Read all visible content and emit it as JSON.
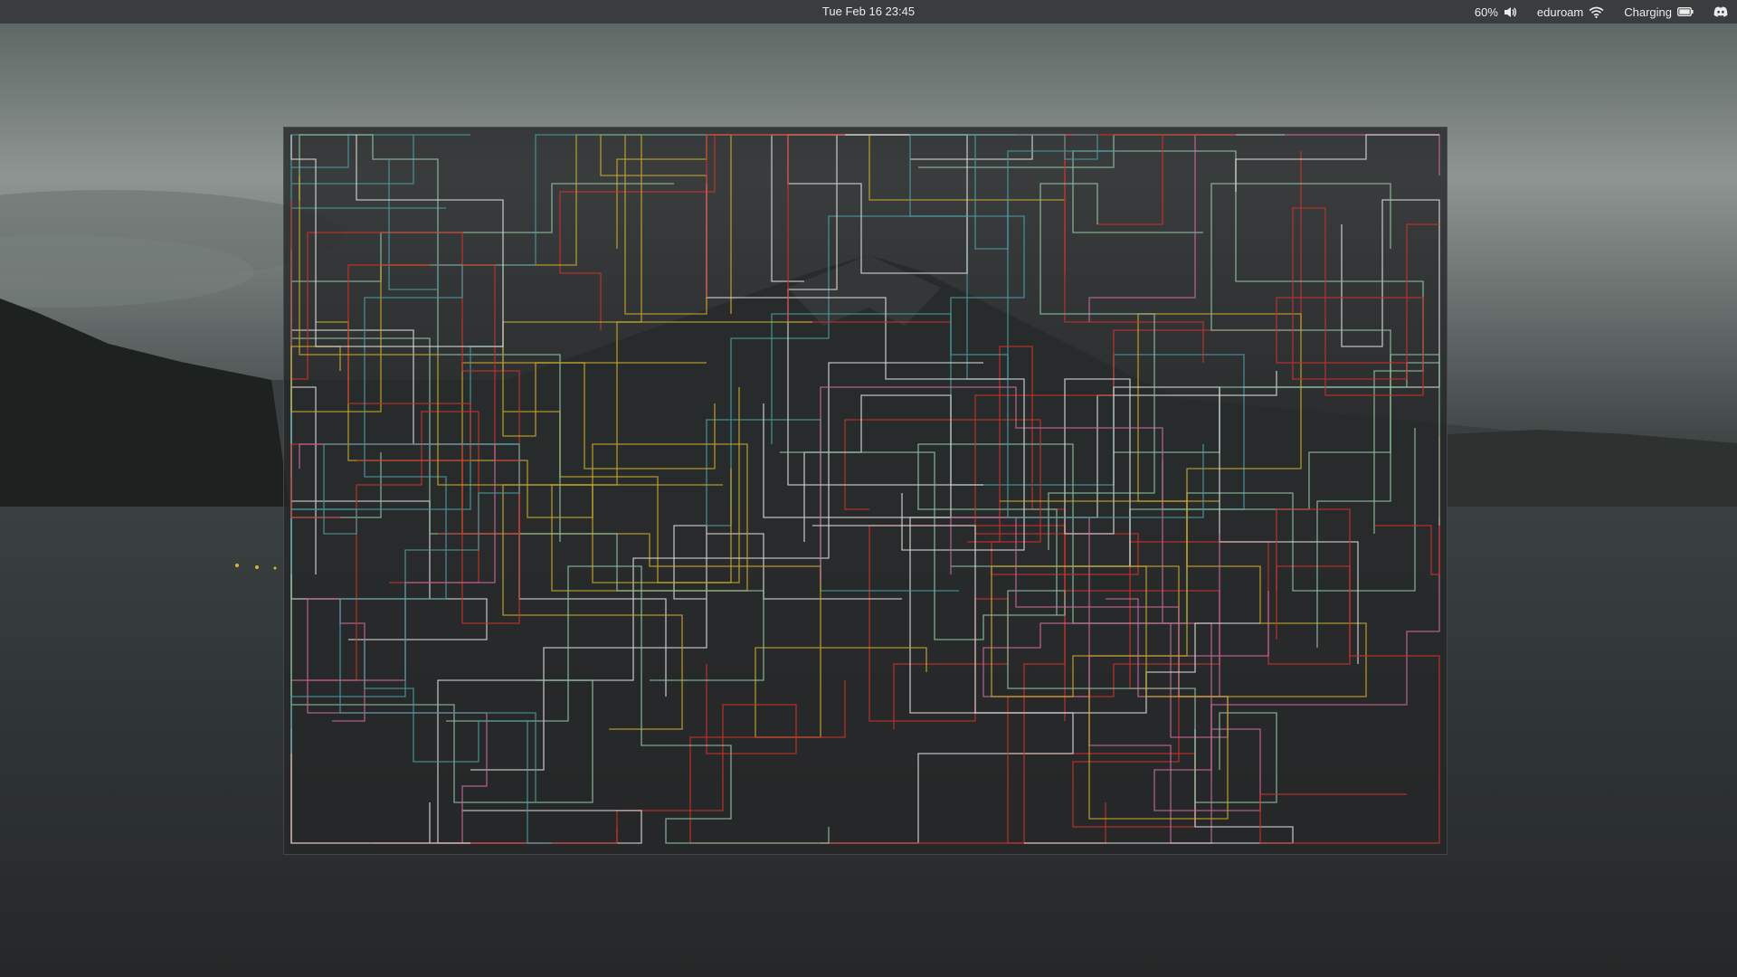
{
  "topbar": {
    "datetime": "Tue Feb 16  23:45",
    "volume_percent": "60%",
    "network_name": "eduroam",
    "power_status": "Charging",
    "icons": [
      "volume-icon",
      "wifi-icon",
      "battery-icon",
      "discord-icon"
    ]
  },
  "window": {
    "content": "pipes-screensaver"
  },
  "colors": {
    "topbar_bg": "#3a3d3e",
    "pipe_red": "#c8322c",
    "pipe_teal": "#4a9aa0",
    "pipe_yellow": "#c8a82a",
    "pipe_green": "#8fbf9f",
    "pipe_pink": "#c86a9a",
    "pipe_white": "#d8d8d8"
  }
}
